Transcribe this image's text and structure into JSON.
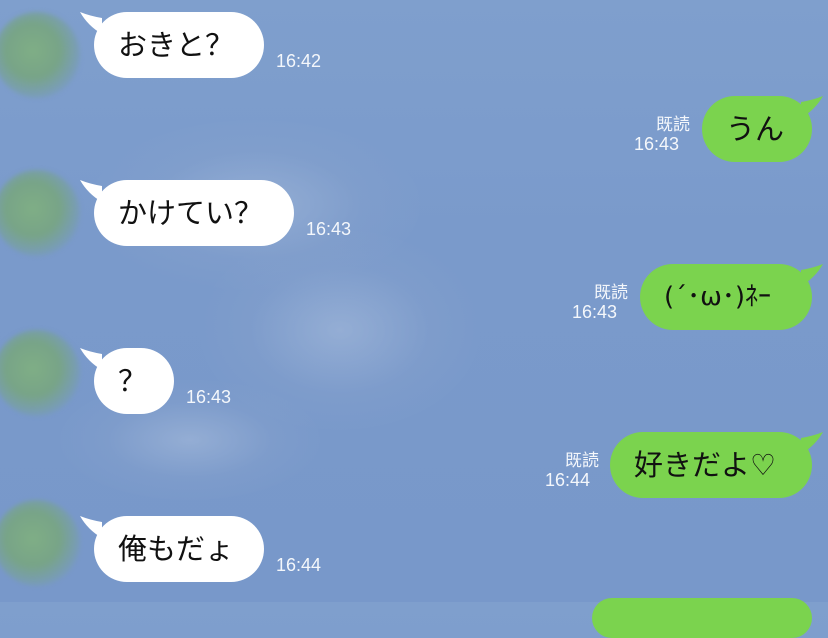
{
  "chat": {
    "messages": [
      {
        "side": "left",
        "text": "おきと？",
        "time": "16:42"
      },
      {
        "side": "right",
        "text": "うん",
        "time": "16:43",
        "read": "既読"
      },
      {
        "side": "left",
        "text": "かけてい？",
        "time": "16:43"
      },
      {
        "side": "right",
        "text": "(´･ω･)ﾈｰ",
        "time": "16:43",
        "read": "既読"
      },
      {
        "side": "left",
        "text": "？",
        "time": "16:43"
      },
      {
        "side": "right",
        "text": "好きだよ♡",
        "time": "16:44",
        "read": "既読"
      },
      {
        "side": "left",
        "text": "俺もだょ",
        "time": "16:44"
      }
    ]
  },
  "colors": {
    "background": "#7a9acb",
    "incoming_bubble": "#ffffff",
    "outgoing_bubble": "#7bd34e",
    "meta_text": "#f4f7fb"
  }
}
